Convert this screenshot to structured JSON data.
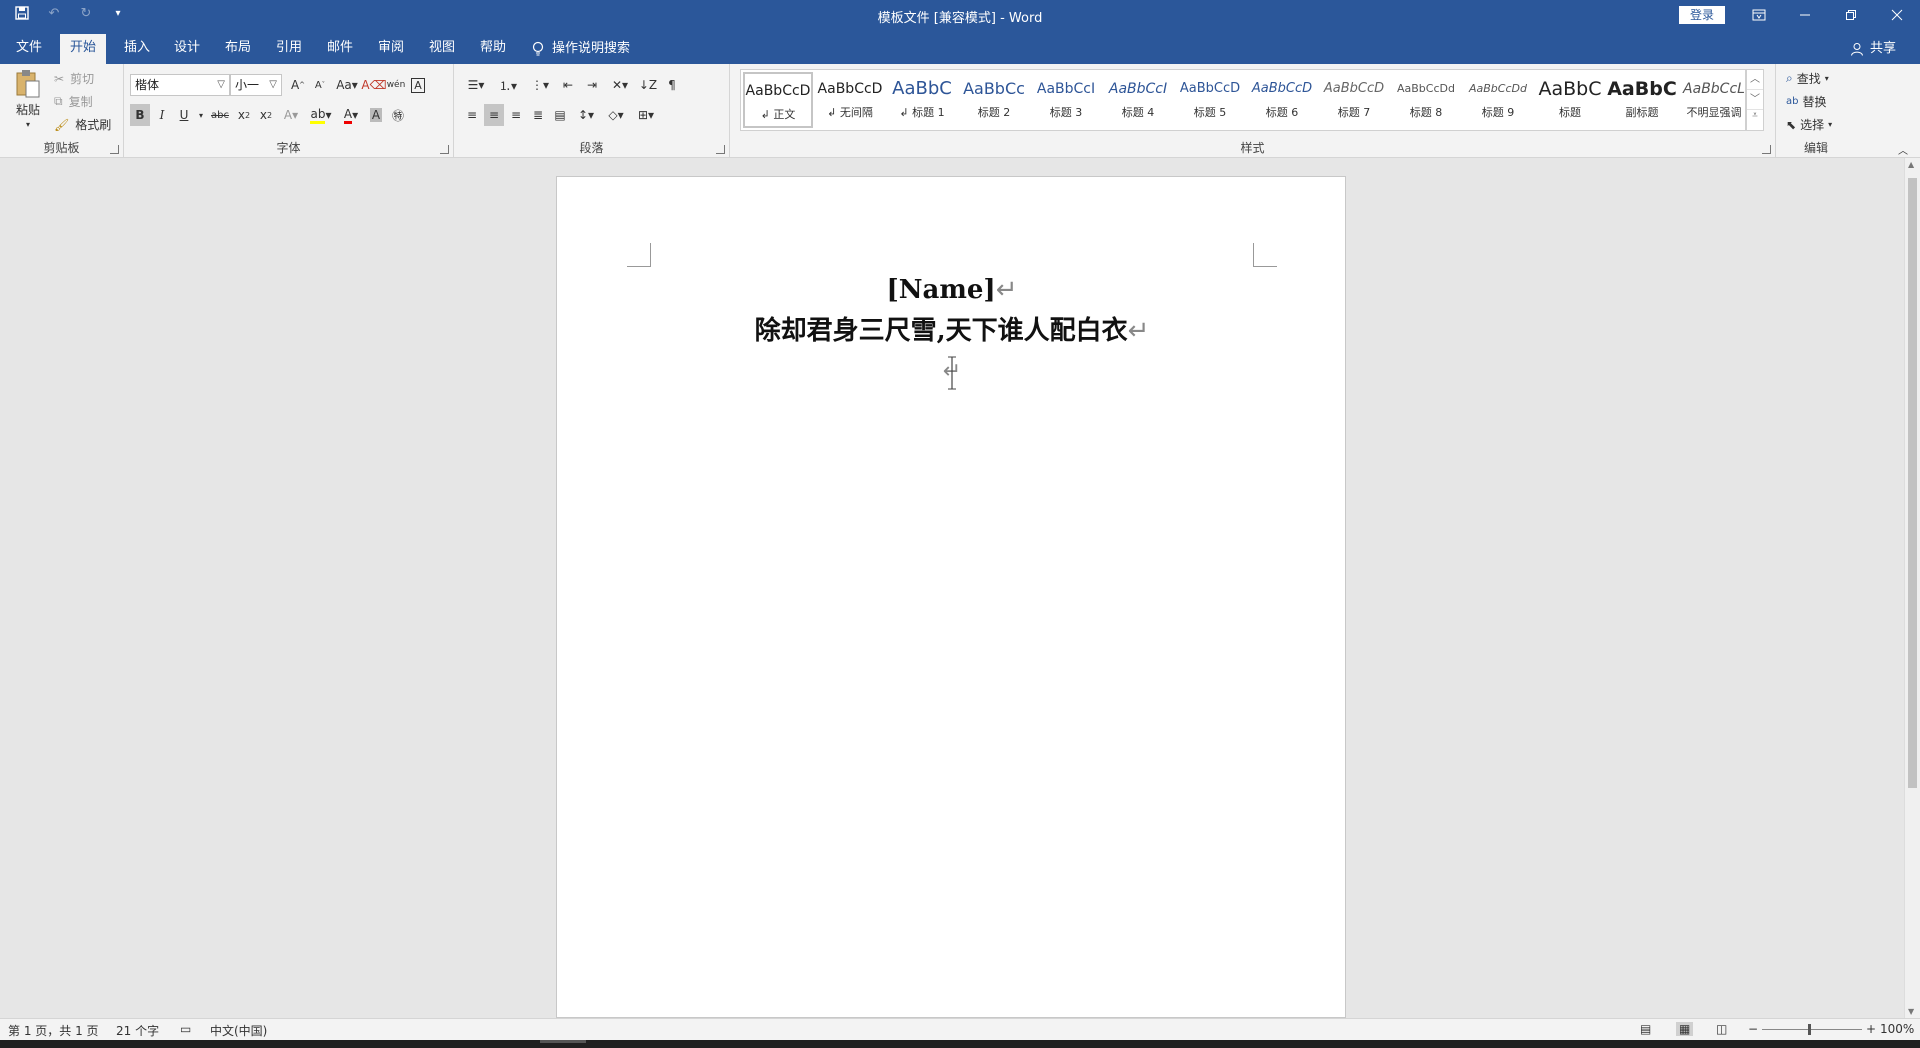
{
  "titlebar": {
    "title": "模板文件 [兼容模式]  -  Word",
    "login_label": "登录"
  },
  "tabs": [
    {
      "label": "文件"
    },
    {
      "label": "开始"
    },
    {
      "label": "插入"
    },
    {
      "label": "设计"
    },
    {
      "label": "布局"
    },
    {
      "label": "引用"
    },
    {
      "label": "邮件"
    },
    {
      "label": "审阅"
    },
    {
      "label": "视图"
    },
    {
      "label": "帮助"
    }
  ],
  "tell_me": "操作说明搜索",
  "share_label": "共享",
  "clipboard": {
    "group_label": "剪贴板",
    "paste": "粘贴",
    "cut": "剪切",
    "copy": "复制",
    "format_painter": "格式刷"
  },
  "font": {
    "group_label": "字体",
    "font_name": "楷体",
    "font_size": "小一"
  },
  "paragraph": {
    "group_label": "段落"
  },
  "styles": {
    "group_label": "样式",
    "items": [
      {
        "sample": "AaBbCcD",
        "name": "↲ 正文"
      },
      {
        "sample": "AaBbCcD",
        "name": "↲ 无间隔"
      },
      {
        "sample": "AaBbC",
        "name": "↲ 标题 1"
      },
      {
        "sample": "AaBbCc",
        "name": "标题 2"
      },
      {
        "sample": "AaBbCcI",
        "name": "标题 3"
      },
      {
        "sample": "AaBbCcI",
        "name": "标题 4"
      },
      {
        "sample": "AaBbCcD",
        "name": "标题 5"
      },
      {
        "sample": "AaBbCcD",
        "name": "标题 6"
      },
      {
        "sample": "AaBbCcD",
        "name": "标题 7"
      },
      {
        "sample": "AaBbCcDd",
        "name": "标题 8"
      },
      {
        "sample": "AaBbCcDd",
        "name": "标题 9"
      },
      {
        "sample": "AaBbC",
        "name": "标题"
      },
      {
        "sample": "AaBbC",
        "name": "副标题"
      },
      {
        "sample": "AaBbCcL",
        "name": "不明显强调"
      }
    ]
  },
  "editing": {
    "group_label": "编辑",
    "find": "查找",
    "replace": "替换",
    "select": "选择"
  },
  "document": {
    "line1": "[Name]",
    "line2": "除却君身三尺雪,天下谁人配白衣",
    "para_mark": "↵"
  },
  "statusbar": {
    "page": "第 1 页，共 1 页",
    "words": "21 个字",
    "language": "中文(中国)",
    "zoom": "100%"
  },
  "colors": {
    "brand": "#2b579a",
    "ribbon_bg": "#f3f3f3",
    "canvas_bg": "#e6e6e6"
  }
}
